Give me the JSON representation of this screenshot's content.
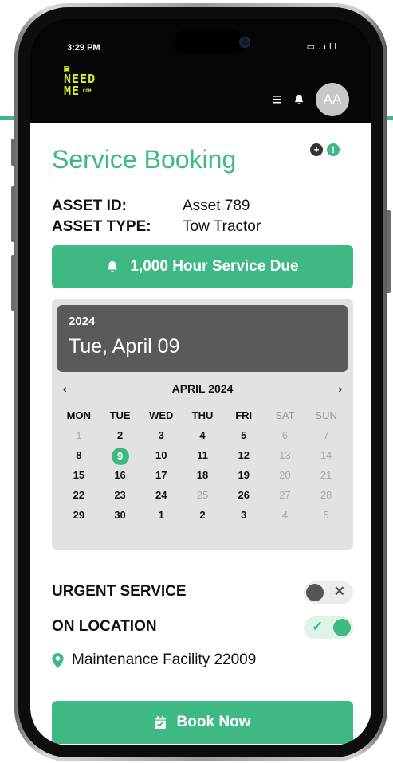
{
  "status_bar": {
    "time": "3:29 PM",
    "icons": "battery-icon, signal-icon"
  },
  "logo": {
    "line1": "NEED",
    "line2": "ME",
    "suffix": ".COM"
  },
  "header": {
    "avatar_initials": "AA"
  },
  "page": {
    "title": "Service Booking"
  },
  "asset": {
    "id_label": "ASSET ID:",
    "id_value": "Asset 789",
    "type_label": "ASSET TYPE:",
    "type_value": "Tow Tractor"
  },
  "alert_button": {
    "label": "1,000 Hour Service Due",
    "icon": "bell-icon"
  },
  "calendar": {
    "year": "2024",
    "selected_date": "Tue, April 09",
    "month_label": "APRIL 2024",
    "prev": "‹",
    "next": "›",
    "weekdays": [
      "MON",
      "TUE",
      "WED",
      "THU",
      "FRI",
      "SAT",
      "SUN"
    ],
    "days": [
      {
        "d": "1",
        "dim": true
      },
      {
        "d": "2"
      },
      {
        "d": "3"
      },
      {
        "d": "4"
      },
      {
        "d": "5"
      },
      {
        "d": "6",
        "dim": true
      },
      {
        "d": "7",
        "dim": true
      },
      {
        "d": "8"
      },
      {
        "d": "9",
        "selected": true
      },
      {
        "d": "10"
      },
      {
        "d": "11"
      },
      {
        "d": "12"
      },
      {
        "d": "13",
        "dim": true
      },
      {
        "d": "14",
        "dim": true
      },
      {
        "d": "15"
      },
      {
        "d": "16"
      },
      {
        "d": "17"
      },
      {
        "d": "18"
      },
      {
        "d": "19"
      },
      {
        "d": "20",
        "dim": true
      },
      {
        "d": "21",
        "dim": true
      },
      {
        "d": "22"
      },
      {
        "d": "23"
      },
      {
        "d": "24"
      },
      {
        "d": "25",
        "dim": true
      },
      {
        "d": "26"
      },
      {
        "d": "27",
        "dim": true
      },
      {
        "d": "28",
        "dim": true
      },
      {
        "d": "29"
      },
      {
        "d": "30"
      },
      {
        "d": "1"
      },
      {
        "d": "2"
      },
      {
        "d": "3"
      },
      {
        "d": "4",
        "dim": true
      },
      {
        "d": "5",
        "dim": true
      }
    ]
  },
  "options": {
    "urgent_label": "URGENT SERVICE",
    "urgent_on": false,
    "location_label": "ON LOCATION",
    "location_on": true
  },
  "location": {
    "name": "Maintenance Facility 22009",
    "icon": "map-pin-icon"
  },
  "book_button": {
    "label": "Book Now",
    "icon": "calendar-check-icon"
  },
  "colors": {
    "accent": "#3fb983",
    "logo": "#d4ee25",
    "calendar_header": "#5a5a5a"
  }
}
